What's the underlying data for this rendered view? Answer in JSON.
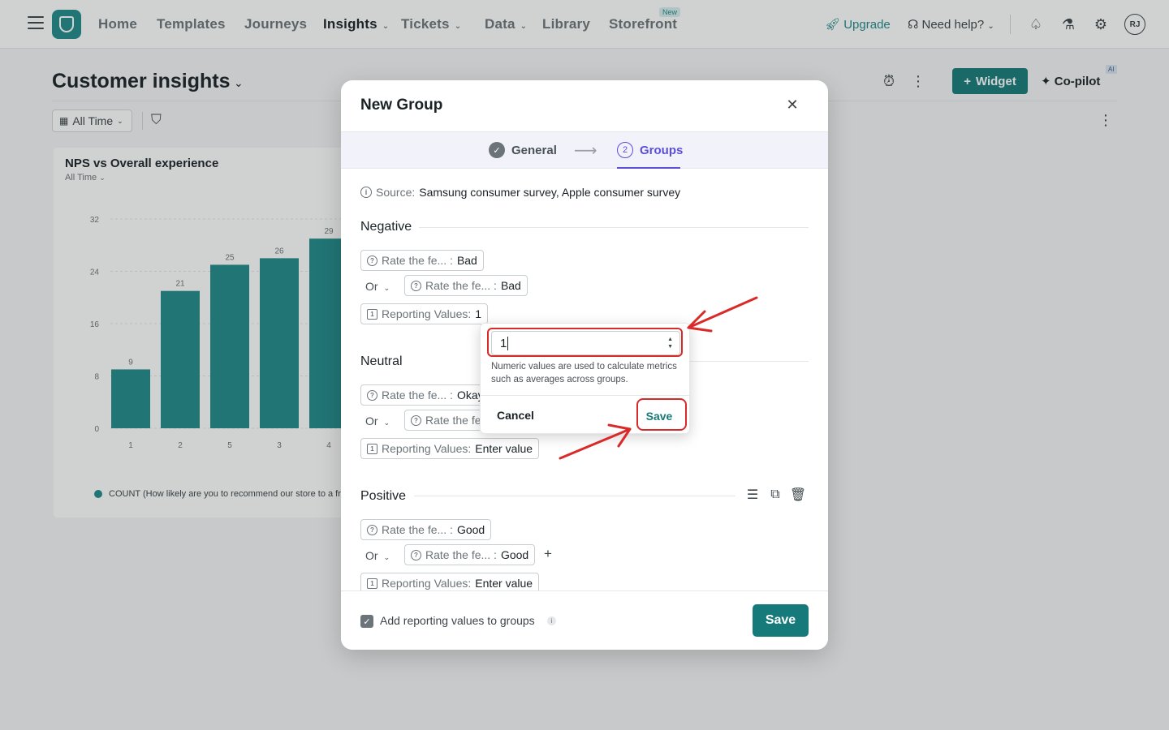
{
  "topnav": {
    "items": [
      {
        "label": "Home"
      },
      {
        "label": "Templates"
      },
      {
        "label": "Journeys"
      },
      {
        "label": "Insights"
      },
      {
        "label": "Tickets"
      },
      {
        "label": "Data"
      },
      {
        "label": "Library"
      },
      {
        "label": "Storefront"
      }
    ],
    "new_badge": "New",
    "upgrade": "Upgrade",
    "need_help": "Need help?",
    "avatar": "RJ"
  },
  "page": {
    "title": "Customer insights",
    "widget_button": "Widget",
    "copilot": "Co-pilot",
    "ai_badge": "AI",
    "time_filter": "All Time"
  },
  "chart_card": {
    "title": "NPS vs Overall experience",
    "subtitle": "All Time",
    "legend": "COUNT (How likely are you to recommend our store to a fr"
  },
  "chart_data": {
    "type": "bar",
    "title": "NPS vs Overall experience",
    "categories": [
      "1",
      "2",
      "5",
      "3",
      "4"
    ],
    "values": [
      9,
      21,
      25,
      26,
      29
    ],
    "yticks": [
      0,
      8,
      16,
      24,
      32
    ],
    "ylim": [
      0,
      32
    ],
    "grid": true,
    "legend_position": "bottom",
    "series": [
      {
        "name": "COUNT (How likely are you to recommend our store to a fr",
        "values": [
          9,
          21,
          25,
          26,
          29
        ]
      }
    ],
    "color": "#1f8a8a"
  },
  "modal": {
    "title": "New Group",
    "steps": {
      "general": "General",
      "groups_num": "2",
      "groups": "Groups"
    },
    "source_label": "Source:",
    "source_value": "Samsung consumer survey, Apple consumer survey",
    "groups": {
      "negative": {
        "label": "Negative",
        "cond1": {
          "field": "Rate the fe... :",
          "value": "Bad"
        },
        "or": "Or",
        "cond2": {
          "field": "Rate the fe... :",
          "value": "Bad"
        },
        "reporting": {
          "label": "Reporting Values:",
          "value": "1"
        }
      },
      "neutral": {
        "label": "Neutral",
        "cond1": {
          "field": "Rate the fe... :",
          "value": "Okay"
        },
        "or": "Or",
        "cond2": {
          "field": "Rate the fe"
        },
        "reporting": {
          "label": "Reporting Values:",
          "value": "Enter value"
        }
      },
      "positive": {
        "label": "Positive",
        "cond1": {
          "field": "Rate the fe... :",
          "value": "Good"
        },
        "or": "Or",
        "cond2": {
          "field": "Rate the fe... :",
          "value": "Good"
        },
        "reporting": {
          "label": "Reporting Values:",
          "value": "Enter value"
        }
      }
    },
    "footer": {
      "checkbox_label": "Add reporting values to groups",
      "save": "Save"
    }
  },
  "popover": {
    "input_value": "1",
    "help": "Numeric values are used to calculate metrics such as averages across groups.",
    "cancel": "Cancel",
    "save": "Save"
  },
  "colors": {
    "accent": "#177a7a",
    "step_active": "#5b4fd6",
    "annotation": "#d92a2a"
  }
}
